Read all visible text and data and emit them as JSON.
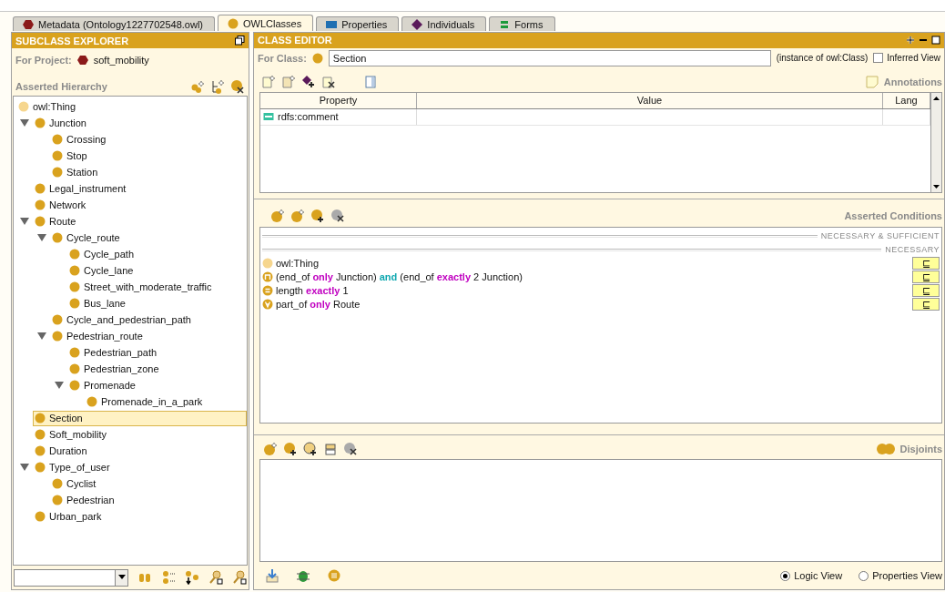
{
  "tabs": [
    {
      "label": "Metadata (Ontology1227702548.owl)",
      "kind": "ontology",
      "selected": false
    },
    {
      "label": "OWLClasses",
      "kind": "class",
      "selected": true
    },
    {
      "label": "Properties",
      "kind": "property",
      "selected": false
    },
    {
      "label": "Individuals",
      "kind": "individual",
      "selected": false
    },
    {
      "label": "Forms",
      "kind": "forms",
      "selected": false
    }
  ],
  "subclass_explorer": {
    "title": "SUBCLASS EXPLORER",
    "project_label": "For Project:",
    "project": "soft_mobility",
    "hierarchy_label": "Asserted Hierarchy",
    "tree": [
      {
        "label": "owl:Thing",
        "kind": "root",
        "selected": false,
        "children": [
          {
            "label": "Junction",
            "selected": false,
            "expanded": true,
            "children": [
              {
                "label": "Crossing",
                "selected": false
              },
              {
                "label": "Stop",
                "selected": false
              },
              {
                "label": "Station",
                "selected": false
              }
            ]
          },
          {
            "label": "Legal_instrument",
            "selected": false
          },
          {
            "label": "Network",
            "selected": false
          },
          {
            "label": "Route",
            "selected": false,
            "expanded": true,
            "children": [
              {
                "label": "Cycle_route",
                "selected": false,
                "expanded": true,
                "children": [
                  {
                    "label": "Cycle_path",
                    "selected": false
                  },
                  {
                    "label": "Cycle_lane",
                    "selected": false
                  },
                  {
                    "label": "Street_with_moderate_traffic",
                    "selected": false
                  },
                  {
                    "label": "Bus_lane",
                    "selected": false
                  }
                ]
              },
              {
                "label": "Cycle_and_pedestrian_path",
                "selected": false
              },
              {
                "label": "Pedestrian_route",
                "selected": false,
                "expanded": true,
                "children": [
                  {
                    "label": "Pedestrian_path",
                    "selected": false
                  },
                  {
                    "label": "Pedestrian_zone",
                    "selected": false
                  },
                  {
                    "label": "Promenade",
                    "selected": false,
                    "expanded": true,
                    "children": [
                      {
                        "label": "Promenade_in_a_park",
                        "selected": false
                      }
                    ]
                  }
                ]
              }
            ]
          },
          {
            "label": "Section",
            "selected": true
          },
          {
            "label": "Soft_mobility",
            "selected": false
          },
          {
            "label": "Duration",
            "selected": false
          },
          {
            "label": "Type_of_user",
            "selected": false,
            "expanded": true,
            "children": [
              {
                "label": "Cyclist",
                "selected": false
              },
              {
                "label": "Pedestrian",
                "selected": false
              }
            ]
          },
          {
            "label": "Urban_park",
            "selected": false
          }
        ]
      }
    ]
  },
  "class_editor": {
    "title": "CLASS EDITOR",
    "class_label": "For Class:",
    "class_name": "Section",
    "instance_of": "(instance of owl:Class)",
    "inferred_view": {
      "label": "Inferred View",
      "checked": false
    },
    "annotations_label": "Annotations",
    "annotations": {
      "columns": [
        "Property",
        "Value",
        "Lang"
      ],
      "rows": [
        {
          "property": "rdfs:comment"
        }
      ]
    },
    "conditions_label": "Asserted Conditions",
    "sections": [
      "NECESSARY & SUFFICIENT",
      "NECESSARY"
    ],
    "conditions": [
      {
        "kind": "named",
        "badge": "⊑",
        "parts": [
          {
            "kind": "plain",
            "text": "owl:Thing"
          }
        ]
      },
      {
        "kind": "intersection",
        "badge": "⊑",
        "parts": [
          {
            "kind": "plain",
            "text": "(end_of "
          },
          {
            "kind": "quantifier",
            "text": "only"
          },
          {
            "kind": "plain",
            "text": " Junction) "
          },
          {
            "kind": "connective",
            "text": "and"
          },
          {
            "kind": "plain",
            "text": " (end_of "
          },
          {
            "kind": "quantifier",
            "text": "exactly"
          },
          {
            "kind": "plain",
            "text": " 2 Junction)"
          }
        ]
      },
      {
        "kind": "cardinality",
        "badge": "⊑",
        "parts": [
          {
            "kind": "plain",
            "text": "length "
          },
          {
            "kind": "quantifier",
            "text": "exactly"
          },
          {
            "kind": "plain",
            "text": " 1"
          }
        ]
      },
      {
        "kind": "universal",
        "badge": "⊑",
        "parts": [
          {
            "kind": "plain",
            "text": "part_of "
          },
          {
            "kind": "quantifier",
            "text": "only"
          },
          {
            "kind": "plain",
            "text": " Route"
          }
        ]
      }
    ],
    "disjoints_label": "Disjoints",
    "views": [
      {
        "label": "Logic View",
        "selected": true
      },
      {
        "label": "Properties View",
        "selected": false
      }
    ]
  }
}
